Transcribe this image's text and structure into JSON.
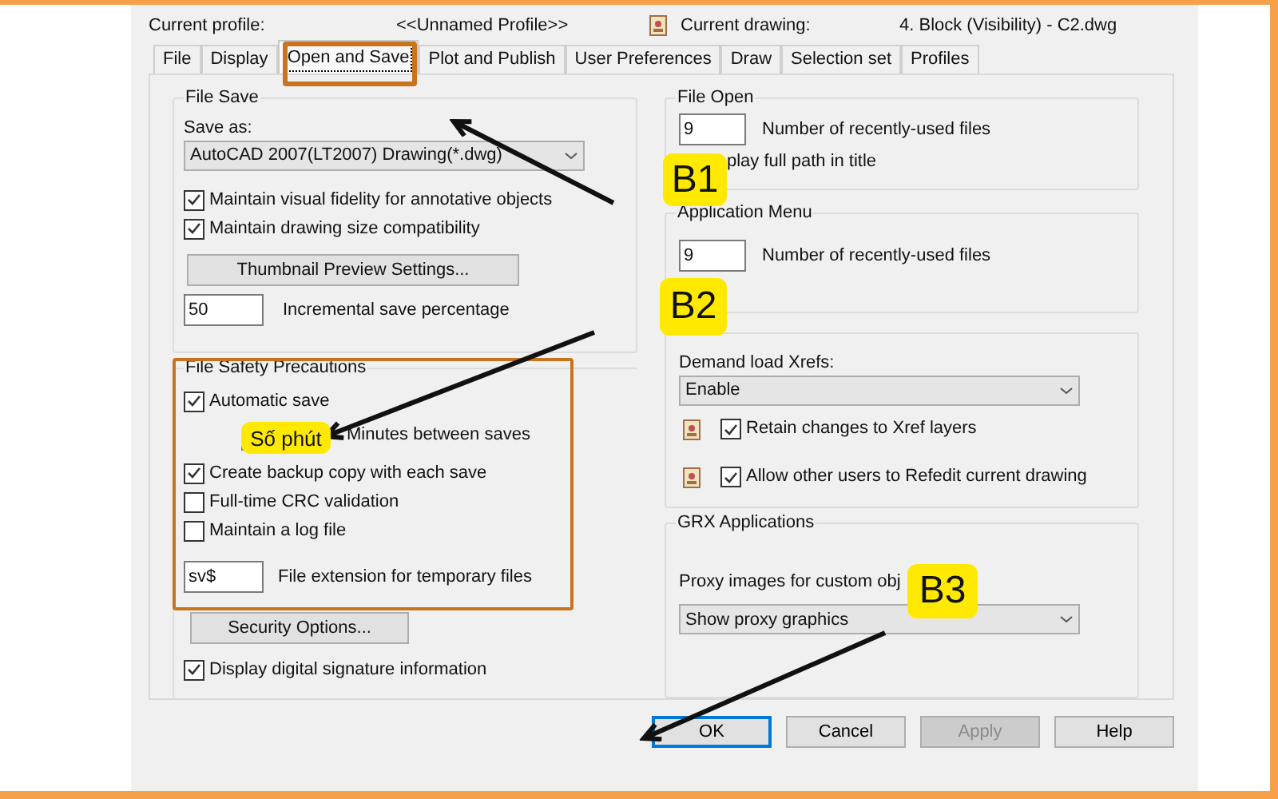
{
  "header": {
    "profile_label": "Current profile:",
    "profile_value": "<<Unnamed Profile>>",
    "drawing_label": "Current drawing:",
    "drawing_value": "4. Block (Visibility) - C2.dwg"
  },
  "tabs": [
    {
      "label": "File",
      "selected": false
    },
    {
      "label": "Display",
      "selected": false
    },
    {
      "label": "Open and Save",
      "selected": true
    },
    {
      "label": "Plot and Publish",
      "selected": false
    },
    {
      "label": "User Preferences",
      "selected": false
    },
    {
      "label": "Draw",
      "selected": false
    },
    {
      "label": "Selection set",
      "selected": false
    },
    {
      "label": "Profiles",
      "selected": false
    }
  ],
  "file_save": {
    "title": "File Save",
    "save_as_label": "Save as:",
    "save_as_value": "AutoCAD 2007(LT2007) Drawing(*.dwg)",
    "checks": [
      {
        "label": "Maintain visual fidelity for annotative objects",
        "checked": true
      },
      {
        "label": "Maintain drawing size compatibility",
        "checked": true
      }
    ],
    "thumbnail_button": "Thumbnail Preview Settings...",
    "incremental_value": "50",
    "incremental_label": "Incremental save percentage"
  },
  "file_safety": {
    "title": "File Safety Precautions",
    "items": [
      {
        "kind": "checkbox",
        "label": "Automatic save",
        "checked": true
      },
      {
        "kind": "field",
        "label": "Minutes between saves"
      },
      {
        "kind": "checkbox",
        "label": "Create backup copy with each save",
        "checked": true
      },
      {
        "kind": "checkbox",
        "label": "Full-time CRC validation",
        "checked": false
      },
      {
        "kind": "checkbox",
        "label": "Maintain a log file",
        "checked": false
      }
    ],
    "temp_extension": {
      "value": "sv$",
      "label": "File extension for temporary files"
    }
  },
  "security_button": "Security Options...",
  "signature": {
    "label": "Display digital signature information",
    "checked": true
  },
  "file_open": {
    "title": "File Open",
    "value": "9",
    "label": "Number of recently-used files",
    "partial_label": "play full path in title"
  },
  "application_menu": {
    "title": "Application Menu",
    "value": "9",
    "label": "Number of recently-used files"
  },
  "xrefs": {
    "demand_label": "Demand load Xrefs:",
    "demand_value": "Enable",
    "checks": [
      {
        "label": "Retain changes to Xref layers",
        "checked": true
      },
      {
        "label": "Allow other users to Refedit current drawing",
        "checked": true
      }
    ]
  },
  "grx": {
    "title": "GRX Applications",
    "proxy_label": "Proxy images for custom obj",
    "proxy_value": "Show proxy graphics"
  },
  "buttons": [
    {
      "label": "OK",
      "kind": "default",
      "disabled": false
    },
    {
      "label": "Cancel",
      "kind": "normal",
      "disabled": false
    },
    {
      "label": "Apply",
      "kind": "normal",
      "disabled": true
    },
    {
      "label": "Help",
      "kind": "normal",
      "disabled": false
    }
  ],
  "callouts": [
    {
      "label": "B1"
    },
    {
      "label": "B2"
    },
    {
      "label": "B3"
    },
    {
      "label": "Số phút"
    }
  ]
}
